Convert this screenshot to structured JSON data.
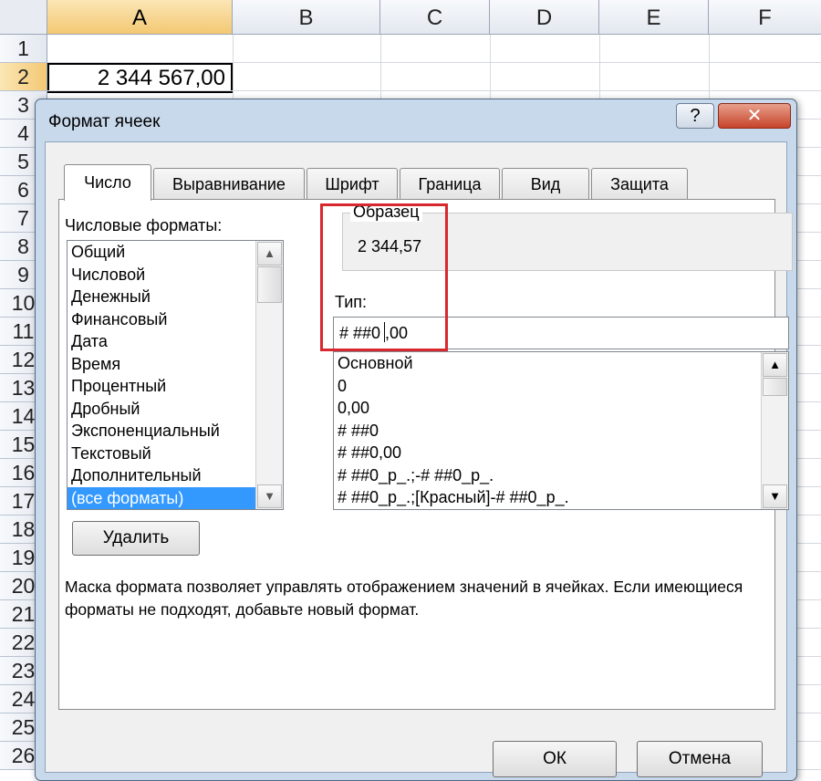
{
  "sheet": {
    "columns": [
      "A",
      "B",
      "C",
      "D",
      "E",
      "F"
    ],
    "rows": [
      "1",
      "2",
      "3",
      "4",
      "5",
      "6",
      "7",
      "8",
      "9",
      "10",
      "11",
      "12",
      "13",
      "14",
      "15",
      "16",
      "17",
      "18",
      "19",
      "20",
      "21",
      "22",
      "23",
      "24",
      "25",
      "26"
    ],
    "cell_a2": "2 344 567,00"
  },
  "dialog": {
    "title": "Формат ячеек",
    "help_glyph": "?",
    "close_glyph": "✕",
    "tabs": [
      "Число",
      "Выравнивание",
      "Шрифт",
      "Граница",
      "Вид",
      "Защита"
    ],
    "active_tab": "Число",
    "number_formats_label": "Числовые форматы:",
    "categories": [
      "Общий",
      "Числовой",
      "Денежный",
      "Финансовый",
      "Дата",
      "Время",
      "Процентный",
      "Дробный",
      "Экспоненциальный",
      "Текстовый",
      "Дополнительный",
      "(все форматы)"
    ],
    "selected_category": "(все форматы)",
    "sample_label": "Образец",
    "sample_value": "2 344,57",
    "type_label": "Тип:",
    "type_value_before_caret": "# ##0",
    "type_value_after_caret": ",00",
    "format_codes": [
      "Основной",
      "0",
      "0,00",
      "# ##0",
      "# ##0,00",
      "# ##0_р_.;-# ##0_р_.",
      "# ##0_р_.;[Красный]-# ##0_р_."
    ],
    "delete_button": "Удалить",
    "hint_text": "Маска формата позволяет управлять отображением значений в ячейках. Если имеющиеся форматы не подходят, добавьте новый формат.",
    "ok_button": "ОК",
    "cancel_button": "Отмена"
  },
  "colors": {
    "highlight_frame": "#d8282e",
    "selection": "#3399ff",
    "dialog_frame": "#c9d9ec"
  }
}
